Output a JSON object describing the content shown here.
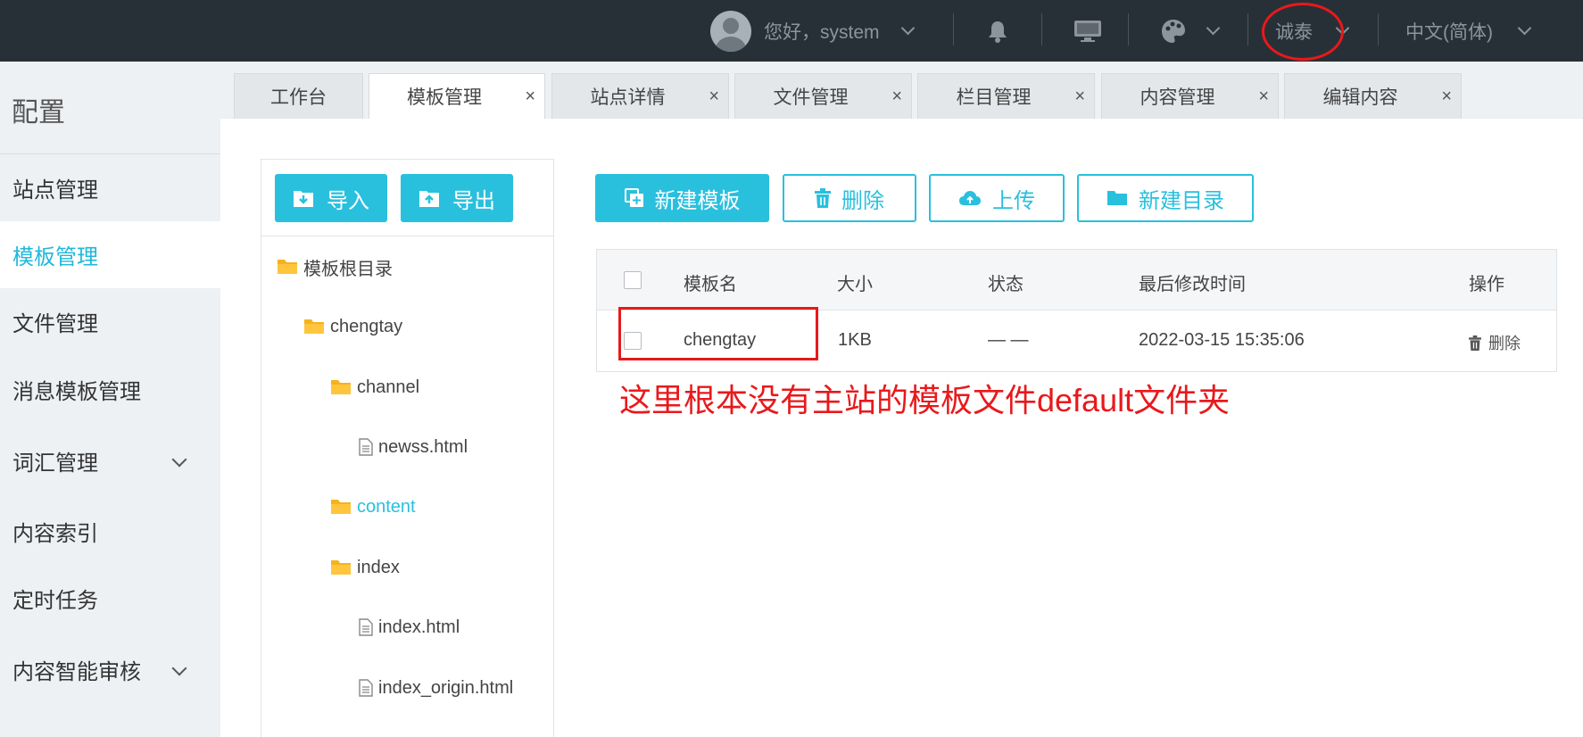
{
  "header": {
    "greeting": "您好，system",
    "site_name": "诚泰",
    "language": "中文(简体)",
    "icons": [
      "avatar",
      "bell-icon",
      "monitor-icon",
      "palette-icon"
    ]
  },
  "sidebar": {
    "title": "配置",
    "items": [
      {
        "label": "站点管理"
      },
      {
        "label": "模板管理"
      },
      {
        "label": "文件管理"
      },
      {
        "label": "消息模板管理"
      },
      {
        "label": "词汇管理"
      },
      {
        "label": "内容索引"
      },
      {
        "label": "定时任务"
      },
      {
        "label": "内容智能审核"
      }
    ],
    "active": "模板管理"
  },
  "tabs": [
    {
      "label": "工作台"
    },
    {
      "label": "模板管理"
    },
    {
      "label": "站点详情"
    },
    {
      "label": "文件管理"
    },
    {
      "label": "栏目管理"
    },
    {
      "label": "内容管理"
    },
    {
      "label": "编辑内容"
    }
  ],
  "tab_close_glyph": "×",
  "tree": {
    "import_label": "导入",
    "export_label": "导出",
    "nodes": [
      {
        "label": "模板根目录",
        "type": "folder"
      },
      {
        "label": "chengtay",
        "type": "folder"
      },
      {
        "label": "channel",
        "type": "folder"
      },
      {
        "label": "newss.html",
        "type": "file"
      },
      {
        "label": "content",
        "type": "folder"
      },
      {
        "label": "index",
        "type": "folder"
      },
      {
        "label": "index.html",
        "type": "file"
      },
      {
        "label": "index_origin.html",
        "type": "file"
      }
    ],
    "active": "content"
  },
  "toolbar": {
    "new_template": "新建模板",
    "delete": "删除",
    "upload": "上传",
    "new_dir": "新建目录"
  },
  "table": {
    "columns": [
      "模板名",
      "大小",
      "状态",
      "最后修改时间",
      "操作"
    ],
    "rows": [
      {
        "name": "chengtay",
        "size": "1KB",
        "status": "— —",
        "modified": "2022-03-15 15:35:06",
        "action": "删除"
      }
    ]
  },
  "annotation": "这里根本没有主站的模板文件default文件夹",
  "colors": {
    "topbar": "#283037",
    "accent": "#29c0de",
    "annotation_red": "#e8191b",
    "sidebar_bg": "#edf1f4"
  }
}
